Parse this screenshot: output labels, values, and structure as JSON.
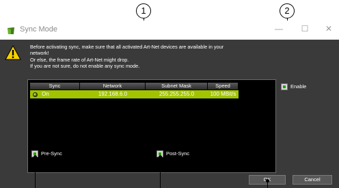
{
  "markers": [
    "1",
    "2"
  ],
  "window": {
    "title": "Sync Mode",
    "icon": "sync-mode-app-icon",
    "minimize": "—",
    "maximize": "☐",
    "close": "✕"
  },
  "warning": {
    "icon": "warning-icon",
    "lines": [
      "Before activating sync, make sure that all activated Art-Net devices are available in your",
      "network!",
      "Or else, the frame rate of Art-Net might drop.",
      "If you are not sure, do not enable any sync mode."
    ]
  },
  "table": {
    "headers": [
      "Sync",
      "Network",
      "Subnet Mask",
      "Speed"
    ],
    "rows": [
      {
        "sync": "On",
        "network": "192.168.6.0",
        "subnet": "255.255.255.0",
        "speed": "100 MBit/s"
      }
    ]
  },
  "options": {
    "enable": "Enable",
    "pre_sync": "Pre-Sync",
    "post_sync": "Post-Sync"
  },
  "buttons": {
    "ok": "OK",
    "cancel": "Cancel"
  },
  "colors": {
    "dialog_bg": "#3a3a3a",
    "row_selected": "#a1c300",
    "checkbox_mark": "#25a000"
  }
}
